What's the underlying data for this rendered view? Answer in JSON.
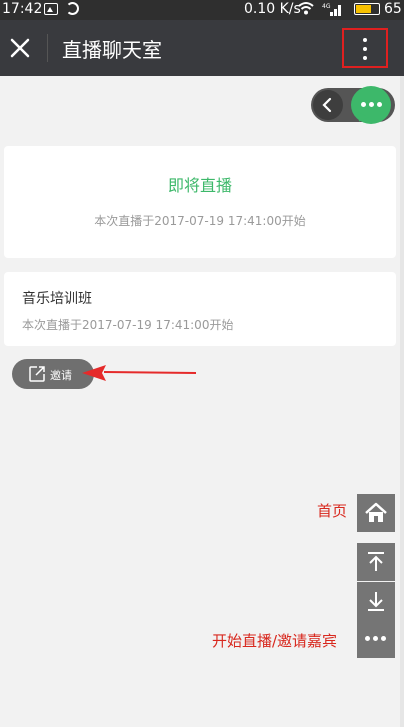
{
  "status_bar": {
    "time": "17:42",
    "network_speed": "0.10 K/s",
    "network_type": "4G",
    "battery_percent": "65",
    "battery_level": 0.65,
    "battery_color": "#f6c000"
  },
  "header": {
    "title": "直播聊天室",
    "close_icon": "close-icon",
    "more_icon": "vertical-dots-icon",
    "highlight_color": "#e02020"
  },
  "toggle": {
    "back_icon": "chevron-left-icon",
    "chat_icon": "chat-bubble-dots-icon",
    "accent": "#3db86a"
  },
  "live_card": {
    "status": "即将直播",
    "start_time": "本次直播于2017-07-19 17:41:00开始"
  },
  "course_card": {
    "name": "音乐培训班",
    "start_time": "本次直播于2017-07-19 17:41:00开始"
  },
  "invite": {
    "label": "邀请",
    "icon": "share-edit-icon"
  },
  "side_controls": {
    "home_label": "首页",
    "start_label": "开始直播/邀请嘉宾",
    "home_icon": "home-icon",
    "top_icon": "scroll-top-icon",
    "bottom_icon": "scroll-bottom-icon",
    "more_icon": "horizontal-dots-icon"
  },
  "colors": {
    "titlebar": "#393a3e",
    "annotation_red": "#d8281e",
    "background": "#f2f2f2"
  }
}
